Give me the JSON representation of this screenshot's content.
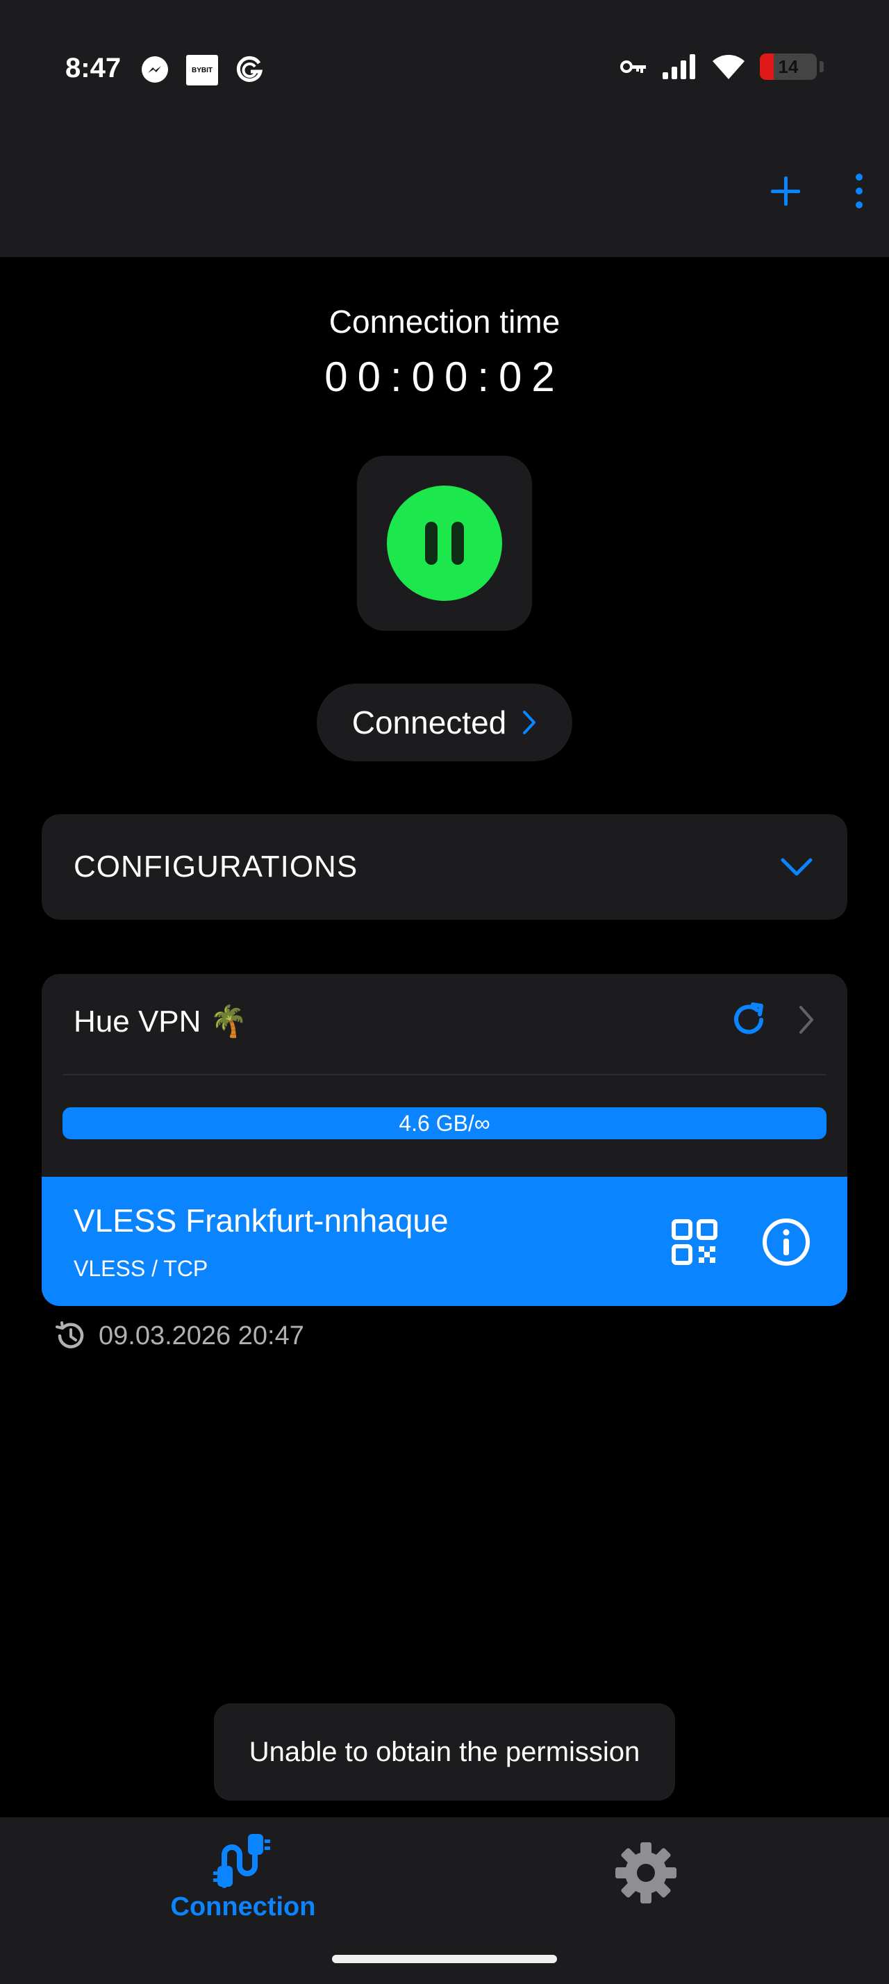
{
  "status_bar": {
    "time": "8:47",
    "app_icons": [
      "messenger-icon",
      "bybit-icon",
      "grammarly-icon"
    ],
    "bybit_text": "BYBIT",
    "system_icons": [
      "vpn-key-icon",
      "signal-icon",
      "wifi-icon"
    ],
    "battery": "14"
  },
  "toolbar": {
    "add_icon": "plus-icon",
    "menu_icon": "more-vert-icon"
  },
  "connection": {
    "time_label": "Connection time",
    "timer": "00:00:02",
    "toggle_icon": "pause-icon",
    "status_text": "Connected"
  },
  "configurations": {
    "label": "CONFIGURATIONS"
  },
  "subscription": {
    "name": "Hue VPN 🌴",
    "usage": "4.6 GB/∞",
    "last_updated": "09.03.2026 20:47",
    "server": {
      "name": "VLESS Frankfurt-nnhaque",
      "protocol": "VLESS / TCP"
    }
  },
  "toast": {
    "message": "Unable to obtain the permission"
  },
  "bottom_nav": {
    "connection_label": "Connection",
    "settings_icon": "gear-icon"
  },
  "colors": {
    "accent": "#0a84ff",
    "connected_green": "#1ce84e",
    "surface": "#1c1c1e",
    "background": "#000000"
  }
}
